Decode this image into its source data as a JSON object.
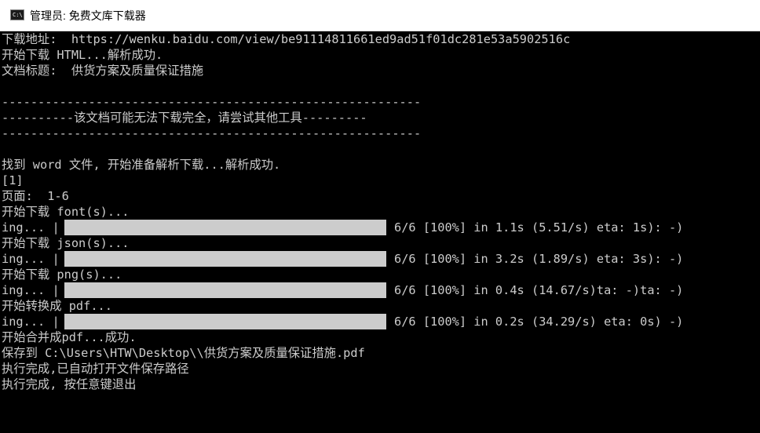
{
  "window": {
    "title": "管理员: 免费文库下载器",
    "icon": "console-icon"
  },
  "console": {
    "lines": [
      "下载地址:  https://wenku.baidu.com/view/be91114811661ed9ad51f01dc281e53a5902516c",
      "开始下载 HTML...解析成功.",
      "文档标题:  供货方案及质量保证措施",
      "",
      "----------------------------------------------------------",
      "----------该文档可能无法下载完全，请尝试其他工具---------",
      "----------------------------------------------------------",
      "",
      "找到 word 文件, 开始准备解析下载...解析成功.",
      "[1]",
      "页面:  1-6",
      "开始下载 font(s)..."
    ],
    "progress": [
      {
        "lead": "ing... |",
        "percent": 100,
        "stats": "6/6 [100%] in 1.1s (5.51/s) eta: 1s): -)",
        "after": "开始下载 json(s)..."
      },
      {
        "lead": "ing... |",
        "percent": 100,
        "stats": "6/6 [100%] in 3.2s (1.89/s) eta: 3s): -)",
        "after": "开始下载 png(s)..."
      },
      {
        "lead": "ing... |",
        "percent": 100,
        "stats": "6/6 [100%] in 0.4s (14.67/s)ta: -)ta: -)",
        "after": "开始转换成 pdf..."
      },
      {
        "lead": "ing... |",
        "percent": 100,
        "stats": "6/6 [100%] in 0.2s (34.29/s) eta: 0s) -)",
        "after": ""
      }
    ],
    "tail": [
      "开始合并成pdf...成功.",
      "保存到 C:\\Users\\HTW\\Desktop\\\\供货方案及质量保证措施.pdf",
      "执行完成,已自动打开文件保存路径",
      "执行完成, 按任意键退出"
    ]
  },
  "colors": {
    "console_bg": "#000000",
    "console_fg": "#cccccc",
    "titlebar_bg": "#ffffff"
  }
}
